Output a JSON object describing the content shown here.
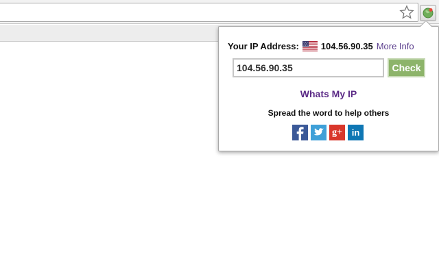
{
  "popup": {
    "ip_label": "Your IP Address:",
    "flag_icon": "us-flag-icon",
    "ip_value": "104.56.90.35",
    "more_info": "More Info",
    "input_value": "104.56.90.35",
    "check_label": "Check",
    "whats_my_ip": "Whats My IP",
    "spread_text": "Spread the word to help others",
    "social": [
      {
        "icon": "facebook-icon",
        "glyph": "f",
        "color": "#3b5998"
      },
      {
        "icon": "twitter-icon",
        "glyph": "",
        "color": "#3fa0d8"
      },
      {
        "icon": "google-plus-icon",
        "glyph": "g+",
        "color": "#d9372b"
      },
      {
        "icon": "linkedin-icon",
        "glyph": "in",
        "color": "#0f77b4"
      }
    ]
  },
  "colors": {
    "check_button": "#8db46a",
    "link": "#5b2a86"
  }
}
